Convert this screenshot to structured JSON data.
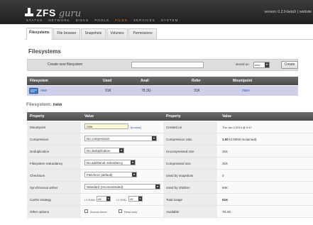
{
  "header": {
    "logo_zfs": "ZFS",
    "logo_guru": "guru",
    "version_text": "version: 0.2.0-beta9",
    "website_link": "website",
    "nav": [
      "STATUS",
      "NETWORK",
      "DISKS",
      "POOLS",
      "FILES",
      "SERVICES",
      "SYSTEM"
    ],
    "active_nav": "FILES",
    "accent_color": "#f07a1a"
  },
  "tabs": [
    "Filesystems",
    "File browser",
    "Snapshots",
    "Volumes",
    "Permissions"
  ],
  "active_tab": "Filesystems",
  "page_title": "Filesystems",
  "create_bar": {
    "label": "Create new filesystem",
    "name_value": "",
    "stored_on_label": "stored on",
    "pool_value": "new",
    "create_button": "Create"
  },
  "fs_table": {
    "columns": [
      "Filesystem",
      "Used",
      "Avail",
      "Refer",
      "Mountpoint"
    ],
    "rows": [
      {
        "name": "new",
        "used": "91K",
        "avail": "78.3G",
        "refer": "31K",
        "mountpoint": "/new"
      }
    ]
  },
  "fs_detail": {
    "title_prefix": "Filesystem:",
    "title_name": "new",
    "columns": [
      "Property",
      "Value",
      "Property",
      "Value"
    ],
    "left": {
      "mountpoint": {
        "label": "Mountpoint",
        "value": "new",
        "browse": "[browse]"
      },
      "compression": {
        "label": "Compression",
        "value": "No compression"
      },
      "deduplication": {
        "label": "Deduplication",
        "value": "No deduplication"
      },
      "redundancy": {
        "label": "Filesystem redundancy",
        "value": "No additional redundancy"
      },
      "checksum": {
        "label": "Checksum",
        "value": "Fletcher2 (default)"
      },
      "sync": {
        "label": "Synchronous writes",
        "value": "Standard (recommended)"
      },
      "cache": {
        "label": "Cache strategy",
        "l1_label": "L1 RAM:",
        "l1_value": "All",
        "l2_label": "L2 SSD:",
        "l2_value": "All"
      },
      "other": {
        "label": "Other options",
        "access_times": "Access times",
        "read_only": "Read-only"
      }
    },
    "right": [
      {
        "label": "Created on",
        "value": "Thu Jan 4 2013 @ 9:47"
      },
      {
        "label": "Compression ratio",
        "value_bold": "1.00",
        "value_rest": " (0.00KB reclaimed)"
      },
      {
        "label": "Uncompressed size",
        "value": "31K"
      },
      {
        "label": "Compressed size",
        "value": "31K"
      },
      {
        "label": "Used by snapshots",
        "value": "0"
      },
      {
        "label": "Used by children",
        "value": "60K"
      },
      {
        "label": "Total usage",
        "value": "91K"
      },
      {
        "label": "Available",
        "value": "78.3G"
      }
    ]
  }
}
